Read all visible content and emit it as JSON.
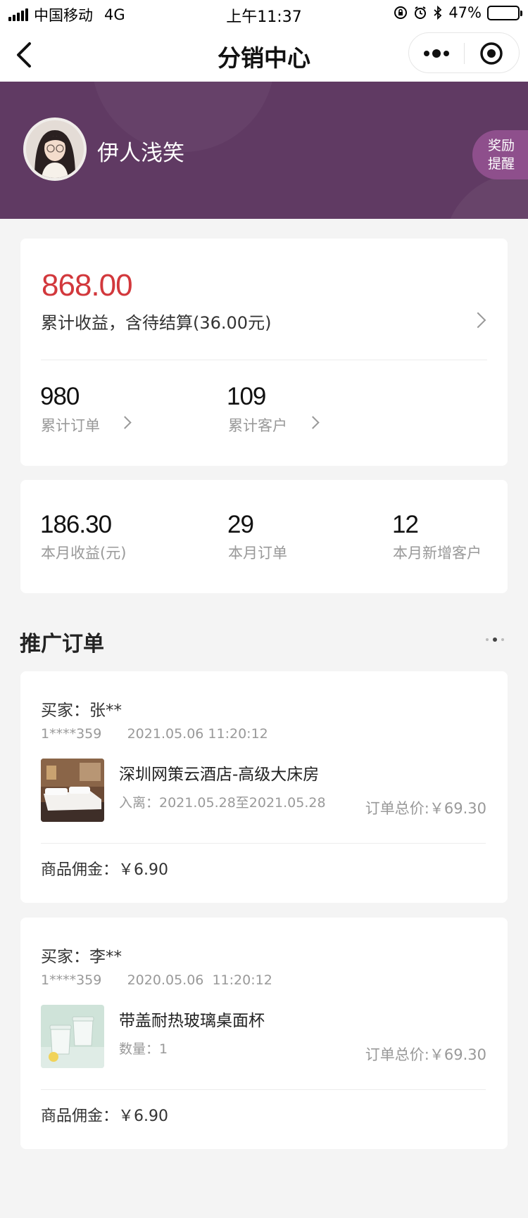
{
  "status_bar": {
    "carrier": "中国移动",
    "network": "4G",
    "time": "上午11:37",
    "battery_pct": "47%"
  },
  "nav": {
    "title": "分销中心",
    "icons": [
      "back-chevron-icon",
      "more-dots-icon",
      "target-circle-icon"
    ]
  },
  "profile": {
    "name": "伊人浅笑",
    "reward_line1": "奖励",
    "reward_line2": "提醒"
  },
  "earnings": {
    "total": "868.00",
    "desc": "累计收益，含待结算(36.00元)",
    "orders_value": "980",
    "orders_label": "累计订单",
    "customers_value": "109",
    "customers_label": "累计客户"
  },
  "monthly": {
    "income_value": "186.30",
    "income_label": "本月收益(元)",
    "orders_value": "29",
    "orders_label": "本月订单",
    "new_customers_value": "12",
    "new_customers_label": "本月新增客户"
  },
  "section": {
    "title": "推广订单"
  },
  "orders": [
    {
      "buyer": "买家：张**",
      "meta": "1****359      2021.05.06 11:20:12",
      "product": "深圳网策云酒店-高级大床房",
      "detail": "入离：2021.05.28至2021.05.28",
      "total": "订单总价:￥69.30",
      "commission": "商品佣金：￥6.90"
    },
    {
      "buyer": "买家：李**",
      "meta": "1****359      2020.05.06  11:20:12",
      "product": "带盖耐热玻璃桌面杯",
      "detail": "数量：1",
      "total": "订单总价:￥69.30",
      "commission": "商品佣金：￥6.90"
    }
  ],
  "colors": {
    "banner": "#603a63",
    "accent_red": "#d2383c",
    "reward_badge": "#8e4f8c",
    "page_bg": "#f4f4f4"
  }
}
